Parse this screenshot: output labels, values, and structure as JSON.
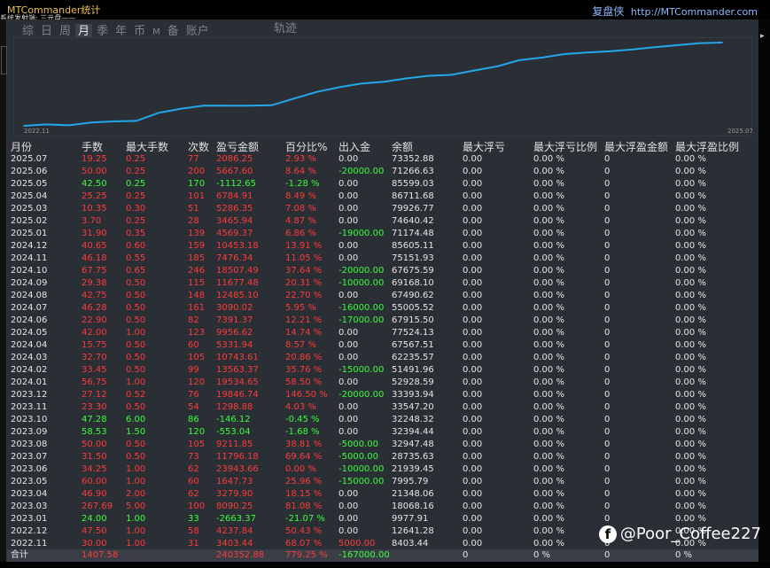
{
  "window": {
    "title": "MTCommander统计",
    "subtitle": "系统发射端: 三元盘——",
    "brand": "复盘侠",
    "url": "http://MTCommander.com"
  },
  "tabs": [
    "综",
    "日",
    "周",
    "月",
    "季",
    "年",
    "币",
    "M",
    "备",
    "账户"
  ],
  "active_tab_index": 3,
  "track_label": "轨迹",
  "chart_data": {
    "type": "line",
    "x_start_label": "2022.11",
    "x_end_label": "2025.07",
    "x": [
      "2022.11",
      "2022.12",
      "2023.01",
      "2023.03",
      "2023.04",
      "2023.05",
      "2023.06",
      "2023.07",
      "2023.08",
      "2023.09",
      "2023.10",
      "2023.11",
      "2023.12",
      "2024.01",
      "2024.02",
      "2024.03",
      "2024.04",
      "2024.05",
      "2024.06",
      "2024.07",
      "2024.08",
      "2024.09",
      "2024.10",
      "2024.11",
      "2024.12",
      "2025.01",
      "2025.02",
      "2025.03",
      "2025.04",
      "2025.05",
      "2025.06",
      "2025.07"
    ],
    "values": [
      3403.44,
      7641.28,
      4977.91,
      13067.91,
      16347.81,
      17995.54,
      41939.45,
      53736.63,
      62947.48,
      62394.44,
      62248.32,
      63546.2,
      83393.94,
      102928.59,
      116491.96,
      127235.57,
      132567.51,
      142524.13,
      149915.76,
      153005.52,
      165490.62,
      177168.1,
      195675.59,
      203151.93,
      213605.11,
      218174.48,
      221640.42,
      226926.77,
      233711.68,
      239599.03,
      245266.63,
      247352.88
    ],
    "color": "#22a8e8"
  },
  "table": {
    "headers": [
      "月份",
      "手数",
      "最大手数",
      "次数",
      "盈亏金额",
      "百分比%",
      "出入金",
      "余额",
      "最大浮亏",
      "最大浮亏比例",
      "最大浮盈金额",
      "最大浮盈比例"
    ],
    "rows": [
      {
        "c": [
          "2025.07",
          "19.25",
          "0.25",
          "77",
          "2086.25",
          "2.93 %",
          "0.00",
          "73352.88",
          "0.00",
          "0.00 %",
          "0",
          "0.00 %"
        ],
        "t": "r"
      },
      {
        "c": [
          "2025.06",
          "50.00",
          "0.25",
          "200",
          "5667.60",
          "8.64 %",
          "-20000.00",
          "71266.63",
          "0.00",
          "0.00 %",
          "0",
          "0.00 %"
        ],
        "t": "r"
      },
      {
        "c": [
          "2025.05",
          "42.50",
          "0.25",
          "170",
          "-1112.65",
          "-1.28 %",
          "0.00",
          "85599.03",
          "0.00",
          "0.00 %",
          "0",
          "0.00 %"
        ],
        "t": "g"
      },
      {
        "c": [
          "2025.04",
          "25.25",
          "0.25",
          "101",
          "6784.91",
          "8.49 %",
          "0.00",
          "86711.68",
          "0.00",
          "0.00 %",
          "0",
          "0.00 %"
        ],
        "t": "r"
      },
      {
        "c": [
          "2025.03",
          "10.35",
          "0.30",
          "51",
          "5286.35",
          "7.08 %",
          "0.00",
          "79926.77",
          "0.00",
          "0.00 %",
          "0",
          "0.00 %"
        ],
        "t": "r"
      },
      {
        "c": [
          "2025.02",
          "3.70",
          "0.25",
          "28",
          "3465.94",
          "4.87 %",
          "0.00",
          "74640.42",
          "0.00",
          "0.00 %",
          "0",
          "0.00 %"
        ],
        "t": "r"
      },
      {
        "c": [
          "2025.01",
          "31.90",
          "0.35",
          "139",
          "4569.37",
          "6.86 %",
          "-19000.00",
          "71174.48",
          "0.00",
          "0.00 %",
          "0",
          "0.00 %"
        ],
        "t": "r"
      },
      {
        "c": [
          "2024.12",
          "40.65",
          "0.60",
          "159",
          "10453.18",
          "13.91 %",
          "0.00",
          "85605.11",
          "0.00",
          "0.00 %",
          "0",
          "0.00 %"
        ],
        "t": "r"
      },
      {
        "c": [
          "2024.11",
          "46.18",
          "0.55",
          "185",
          "7476.34",
          "11.05 %",
          "0.00",
          "75151.93",
          "0.00",
          "0.00 %",
          "0",
          "0.00 %"
        ],
        "t": "r"
      },
      {
        "c": [
          "2024.10",
          "67.75",
          "0.65",
          "246",
          "18507.49",
          "37.64 %",
          "-20000.00",
          "67675.59",
          "0.00",
          "0.00 %",
          "0",
          "0.00 %"
        ],
        "t": "r"
      },
      {
        "c": [
          "2024.09",
          "29.38",
          "0.50",
          "115",
          "11677.48",
          "20.31 %",
          "-10000.00",
          "69168.10",
          "0.00",
          "0.00 %",
          "0",
          "0.00 %"
        ],
        "t": "r"
      },
      {
        "c": [
          "2024.08",
          "42.75",
          "0.50",
          "148",
          "12485.10",
          "22.70 %",
          "0.00",
          "67490.62",
          "0.00",
          "0.00 %",
          "0",
          "0.00 %"
        ],
        "t": "r"
      },
      {
        "c": [
          "2024.07",
          "46.28",
          "0.50",
          "161",
          "3090.02",
          "5.95 %",
          "-16000.00",
          "55005.52",
          "0.00",
          "0.00 %",
          "0",
          "0.00 %"
        ],
        "t": "r"
      },
      {
        "c": [
          "2024.06",
          "22.90",
          "0.50",
          "82",
          "7391.37",
          "12.21 %",
          "-17000.00",
          "67915.50",
          "0.00",
          "0.00 %",
          "0",
          "0.00 %"
        ],
        "t": "r"
      },
      {
        "c": [
          "2024.05",
          "42.00",
          "1.00",
          "123",
          "9956.62",
          "14.74 %",
          "0.00",
          "77524.13",
          "0.00",
          "0.00 %",
          "0",
          "0.00 %"
        ],
        "t": "r"
      },
      {
        "c": [
          "2024.04",
          "15.75",
          "0.50",
          "60",
          "5331.94",
          "8.57 %",
          "0.00",
          "67567.51",
          "0.00",
          "0.00 %",
          "0",
          "0.00 %"
        ],
        "t": "r"
      },
      {
        "c": [
          "2024.03",
          "32.70",
          "0.50",
          "105",
          "10743.61",
          "20.86 %",
          "0.00",
          "62235.57",
          "0.00",
          "0.00 %",
          "0",
          "0.00 %"
        ],
        "t": "r"
      },
      {
        "c": [
          "2024.02",
          "33.45",
          "0.50",
          "99",
          "13563.37",
          "35.76 %",
          "-15000.00",
          "51491.96",
          "0.00",
          "0.00 %",
          "0",
          "0.00 %"
        ],
        "t": "r"
      },
      {
        "c": [
          "2024.01",
          "56.75",
          "1.00",
          "120",
          "19534.65",
          "58.50 %",
          "0.00",
          "52928.59",
          "0.00",
          "0.00 %",
          "0",
          "0.00 %"
        ],
        "t": "r"
      },
      {
        "c": [
          "2023.12",
          "27.12",
          "0.52",
          "76",
          "19846.74",
          "146.50 %",
          "-20000.00",
          "33393.94",
          "0.00",
          "0.00 %",
          "0",
          "0.00 %"
        ],
        "t": "r"
      },
      {
        "c": [
          "2023.11",
          "23.30",
          "0.50",
          "54",
          "1298.88",
          "4.03 %",
          "0.00",
          "33547.20",
          "0.00",
          "0.00 %",
          "0",
          "0.00 %"
        ],
        "t": "r"
      },
      {
        "c": [
          "2023.10",
          "47.28",
          "6.00",
          "86",
          "-146.12",
          "-0.45 %",
          "0.00",
          "32248.32",
          "0.00",
          "0.00 %",
          "0",
          "0.00 %"
        ],
        "t": "g"
      },
      {
        "c": [
          "2023.09",
          "58.53",
          "1.50",
          "120",
          "-553.04",
          "-1.68 %",
          "0.00",
          "32394.44",
          "0.00",
          "0.00 %",
          "0",
          "0.00 %"
        ],
        "t": "g"
      },
      {
        "c": [
          "2023.08",
          "50.00",
          "0.50",
          "105",
          "9211.85",
          "38.81 %",
          "-5000.00",
          "32947.48",
          "0.00",
          "0.00 %",
          "0",
          "0.00 %"
        ],
        "t": "r"
      },
      {
        "c": [
          "2023.07",
          "31.50",
          "0.50",
          "73",
          "11796.18",
          "69.64 %",
          "-5000.00",
          "28735.63",
          "0.00",
          "0.00 %",
          "0",
          "0.00 %"
        ],
        "t": "r"
      },
      {
        "c": [
          "2023.06",
          "34.25",
          "1.00",
          "62",
          "23943.66",
          "0.00 %",
          "-10000.00",
          "21939.45",
          "0.00",
          "0.00 %",
          "0",
          "0.00 %"
        ],
        "t": "r"
      },
      {
        "c": [
          "2023.05",
          "60.00",
          "1.00",
          "60",
          "1647.73",
          "25.96 %",
          "-15000.00",
          "7995.79",
          "0.00",
          "0.00 %",
          "0",
          "0.00 %"
        ],
        "t": "r"
      },
      {
        "c": [
          "2023.04",
          "46.90",
          "2.00",
          "62",
          "3279.90",
          "18.15 %",
          "0.00",
          "21348.06",
          "0.00",
          "0.00 %",
          "0",
          "0.00 %"
        ],
        "t": "r"
      },
      {
        "c": [
          "2023.03",
          "267.69",
          "5.00",
          "100",
          "8090.25",
          "81.08 %",
          "0.00",
          "18068.16",
          "0.00",
          "0.00 %",
          "0",
          "0.00 %"
        ],
        "t": "r"
      },
      {
        "c": [
          "2023.01",
          "24.00",
          "1.00",
          "33",
          "-2663.37",
          "-21.07 %",
          "0.00",
          "9977.91",
          "0.00",
          "0.00 %",
          "0",
          "0.00 %"
        ],
        "t": "g"
      },
      {
        "c": [
          "2022.12",
          "47.50",
          "1.00",
          "58",
          "4237.84",
          "50.43 %",
          "0.00",
          "12641.28",
          "0.00",
          "0.00 %",
          "0",
          "0.00 %"
        ],
        "t": "r"
      },
      {
        "c": [
          "2022.11",
          "30.00",
          "1.00",
          "31",
          "3403.44",
          "68.07 %",
          "5000.00",
          "8403.44",
          "0.00",
          "0.00 %",
          "0",
          "0.00 %"
        ],
        "t": "r"
      }
    ],
    "total": [
      "合计",
      "1407.58",
      "",
      "",
      "240352.88",
      "779.25 %",
      "-167000.00",
      "",
      "0",
      "0 %",
      "0",
      "0 %"
    ]
  },
  "watermark": {
    "icon": "facebook-icon",
    "text": "@Poor_Coffee227"
  }
}
